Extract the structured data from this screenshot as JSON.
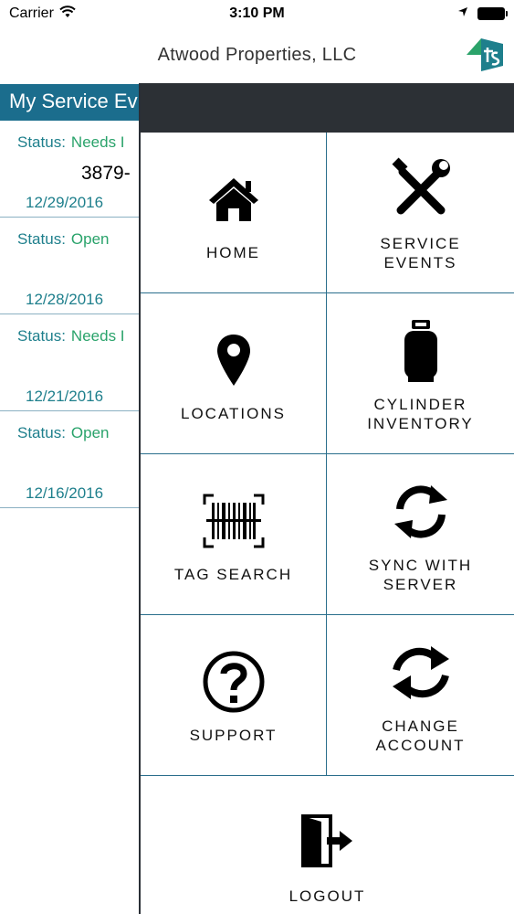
{
  "statusbar": {
    "carrier": "Carrier",
    "time": "3:10 PM",
    "wifi_icon": "wifi-icon",
    "location_icon": "location-arrow-icon",
    "battery_icon": "battery-icon"
  },
  "navbar": {
    "title": "Atwood Properties, LLC",
    "logo_icon": "company-logo"
  },
  "list": {
    "header": "My Service Ev",
    "items": [
      {
        "status_label": "Status:",
        "status_value": "Needs I",
        "extra": "3879-",
        "date": "12/29/2016"
      },
      {
        "status_label": "Status:",
        "status_value": "Open",
        "extra": "",
        "date": "12/28/2016"
      },
      {
        "status_label": "Status:",
        "status_value": "Needs I",
        "extra": "",
        "date": "12/21/2016"
      },
      {
        "status_label": "Status:",
        "status_value": "Open",
        "extra": "",
        "date": "12/16/2016"
      }
    ]
  },
  "menu": {
    "items": [
      {
        "label": "HOME",
        "icon": "home-icon"
      },
      {
        "label": "SERVICE\nEVENTS",
        "icon": "tools-icon"
      },
      {
        "label": "LOCATIONS",
        "icon": "map-pin-icon"
      },
      {
        "label": "CYLINDER\nINVENTORY",
        "icon": "gas-cylinder-icon"
      },
      {
        "label": "TAG SEARCH",
        "icon": "barcode-scan-icon"
      },
      {
        "label": "SYNC WITH\nSERVER",
        "icon": "sync-icon"
      },
      {
        "label": "SUPPORT",
        "icon": "question-circle-icon"
      },
      {
        "label": "CHANGE\nACCOUNT",
        "icon": "switch-account-icon"
      }
    ],
    "logout": {
      "label": "LOGOUT",
      "icon": "logout-icon"
    }
  },
  "colors": {
    "header_blue": "#1b6d8d",
    "status_teal": "#1e7f8c",
    "status_green": "#2aa36b",
    "drawer_top": "#2c3035",
    "grid_line": "#2a6e8c"
  }
}
